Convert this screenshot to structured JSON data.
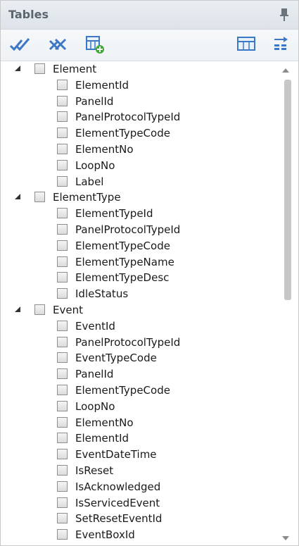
{
  "panel": {
    "title": "Tables"
  },
  "toolbar": {
    "buttons": [
      {
        "icon": "check-all-icon"
      },
      {
        "icon": "uncheck-all-icon"
      },
      {
        "icon": "add-table-icon"
      },
      {
        "icon": "table-layout-icon"
      },
      {
        "icon": "arrange-icon"
      }
    ]
  },
  "tree": [
    {
      "label": "Element",
      "items": [
        "ElementId",
        "PanelId",
        "PanelProtocolTypeId",
        "ElementTypeCode",
        "ElementNo",
        "LoopNo",
        "Label"
      ]
    },
    {
      "label": "ElementType",
      "items": [
        "ElementTypeId",
        "PanelProtocolTypeId",
        "ElementTypeCode",
        "ElementTypeName",
        "ElementTypeDesc",
        "IdleStatus"
      ]
    },
    {
      "label": "Event",
      "items": [
        "EventId",
        "PanelProtocolTypeId",
        "EventTypeCode",
        "PanelId",
        "ElementTypeCode",
        "LoopNo",
        "ElementNo",
        "ElementId",
        "EventDateTime",
        "IsReset",
        "IsAcknowledged",
        "IsServicedEvent",
        "SetResetEventId",
        "EventBoxId"
      ]
    }
  ]
}
